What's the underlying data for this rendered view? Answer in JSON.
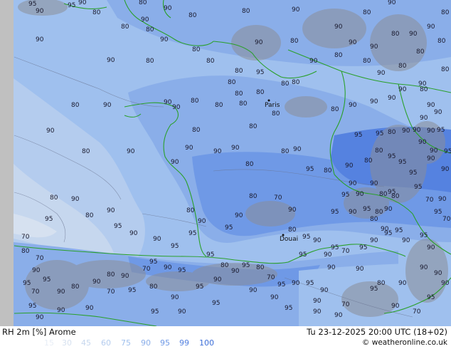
{
  "title": "RH 2m [%] Arome",
  "datetime": "Tu 23-12-2025 20:00 UTC (18+02)",
  "credit": "© weatheronline.co.uk",
  "legend": {
    "values": [
      "15",
      "30",
      "45",
      "60",
      "75",
      "90",
      "95",
      "99",
      "100"
    ],
    "colors": [
      "#e8eef6",
      "#d6e1f0",
      "#c6d7ee",
      "#b4ccee",
      "#9fc0ee",
      "#8aaee9",
      "#6f99e6",
      "#5582e0",
      "#3d6fd8"
    ]
  },
  "map": {
    "cities": [
      {
        "name": "Paris"
      },
      {
        "name": "Douai"
      }
    ],
    "contour_labels": [
      "95",
      "90",
      "95",
      "90",
      "80",
      "80",
      "90",
      "80",
      "80",
      "90",
      "90",
      "80",
      "80",
      "90",
      "80",
      "90",
      "80",
      "80",
      "90",
      "80",
      "90",
      "80",
      "95",
      "80",
      "80",
      "80",
      "80",
      "90",
      "80",
      "90",
      "80",
      "90",
      "90",
      "80",
      "90",
      "80",
      "90",
      "90",
      "80",
      "90",
      "80",
      "80",
      "80",
      "80",
      "90",
      "90",
      "80",
      "90",
      "90",
      "80",
      "90",
      "90",
      "90",
      "90",
      "80",
      "80",
      "80",
      "80",
      "80",
      "80",
      "80",
      "90",
      "90",
      "80",
      "80",
      "90",
      "90",
      "95",
      "80",
      "80",
      "90",
      "90",
      "90",
      "90",
      "80",
      "95",
      "95",
      "80",
      "90",
      "90",
      "90",
      "90",
      "90",
      "95",
      "90",
      "90",
      "80",
      "80",
      "95",
      "95",
      "90",
      "90",
      "95",
      "90",
      "90",
      "95",
      "95",
      "70",
      "90",
      "95",
      "80",
      "90",
      "90",
      "95",
      "95",
      "90",
      "95",
      "80",
      "90",
      "80",
      "80",
      "90",
      "95",
      "95",
      "90",
      "95",
      "95",
      "70",
      "90",
      "90",
      "95",
      "70",
      "95",
      "90",
      "90",
      "95",
      "80",
      "70",
      "90",
      "80",
      "90",
      "95",
      "80",
      "90",
      "95",
      "95",
      "90",
      "90",
      "95",
      "80",
      "90",
      "90",
      "80",
      "95",
      "70",
      "80",
      "70",
      "90",
      "95",
      "95",
      "70",
      "90",
      "80",
      "90",
      "80",
      "90",
      "70",
      "95",
      "90",
      "95",
      "95",
      "80",
      "90",
      "95",
      "80",
      "70",
      "95",
      "90",
      "90",
      "95",
      "90",
      "80",
      "95",
      "70",
      "90",
      "90",
      "95",
      "90",
      "95",
      "90",
      "95",
      "90",
      "90",
      "95",
      "90",
      "90",
      "90",
      "95",
      "90",
      "70",
      "95",
      "90",
      "90",
      "90",
      "90",
      "80",
      "70",
      "90",
      "90",
      "95",
      "90",
      "95",
      "80",
      "70",
      "90",
      "95",
      "80",
      "90",
      "80",
      "80",
      "90",
      "95",
      "80",
      "80",
      "90",
      "90",
      "80",
      "70",
      "80",
      "70",
      "90"
    ]
  }
}
